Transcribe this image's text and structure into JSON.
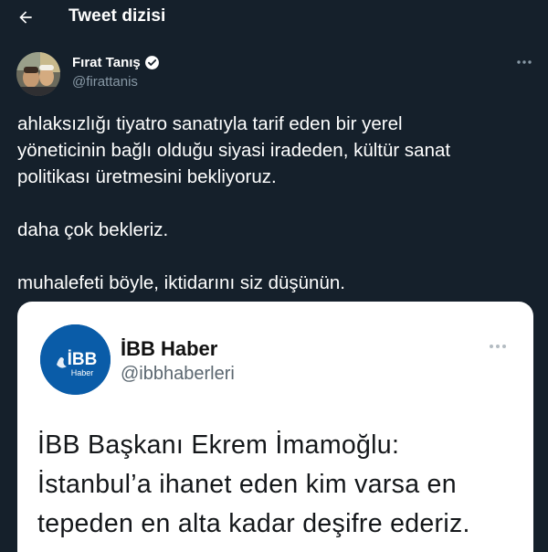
{
  "header": {
    "title": "Tweet dizisi",
    "back_icon": "arrow-left-icon"
  },
  "author": {
    "name": "Fırat Tanış",
    "handle": "@firattanis",
    "verified": true
  },
  "tweet": {
    "lines": [
      "ahlaksızlığı tiyatro sanatıyla tarif eden bir yerel",
      "yöneticinin bağlı olduğu siyasi iradeden, kültür sanat",
      "politikası üretmesini bekliyoruz.",
      "daha çok bekleriz.",
      "muhalefeti böyle, iktidarını siz düşünün."
    ]
  },
  "quoted_image": {
    "logo_text": "İBB",
    "logo_subtext": "Haber",
    "name": "İBB Haber",
    "handle": "@ibbhaberleri",
    "lines": [
      "İBB Başkanı Ekrem İmamoğlu:",
      "İstanbul’a ihanet eden kim varsa en",
      "tepeden en alta kadar deşifre ederiz."
    ]
  },
  "colors": {
    "background": "#15202b",
    "text": "#ffffff",
    "secondary_text": "#8899a6",
    "accent": "#1da1f2",
    "logo_blue": "#0a5ca8"
  }
}
